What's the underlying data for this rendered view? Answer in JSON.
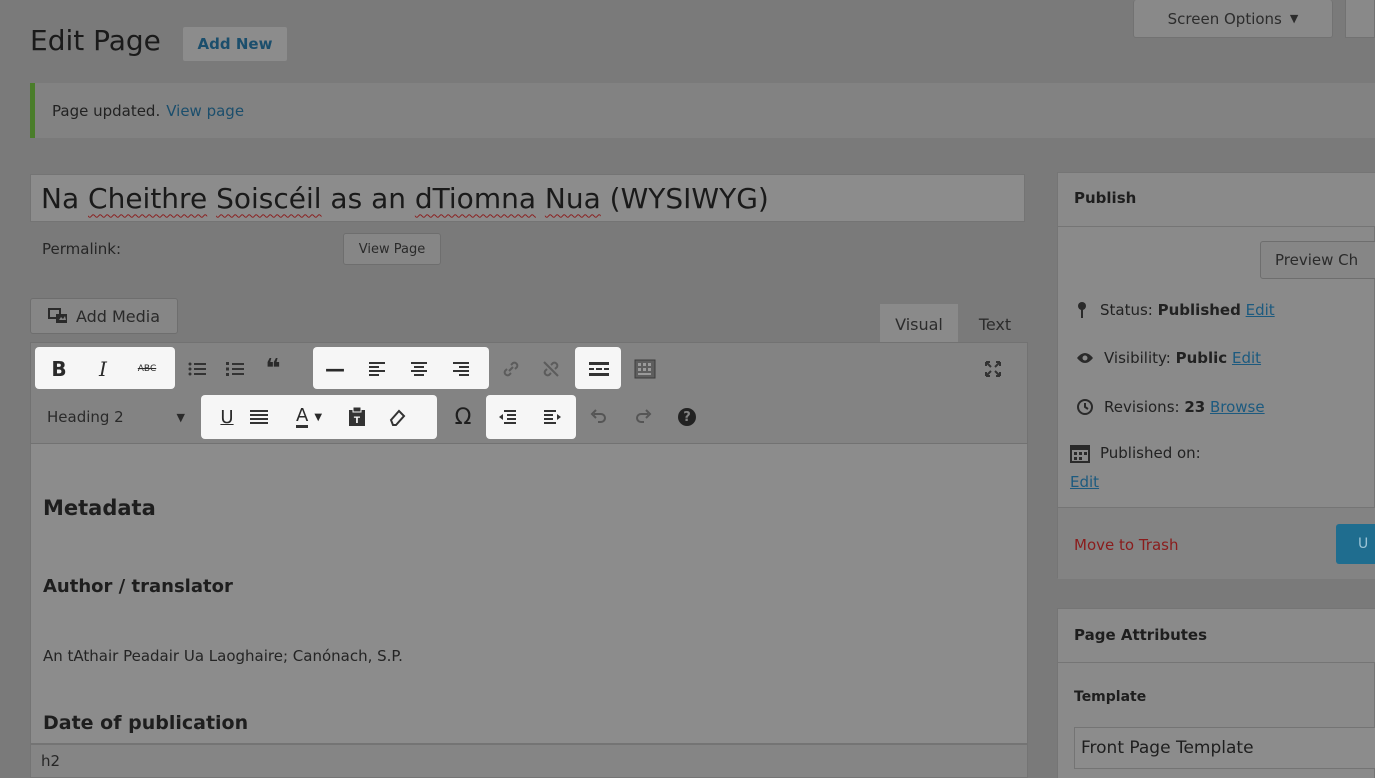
{
  "header": {
    "screen_options": "Screen Options",
    "page_title": "Edit Page",
    "add_new": "Add New"
  },
  "notice": {
    "text": "Page updated.",
    "link": "View page"
  },
  "editor": {
    "title_parts": [
      "Na ",
      "Cheithre",
      " ",
      "Soiscéil",
      " as an ",
      "dTiomna",
      " ",
      "Nua",
      " (WYSIWYG)"
    ],
    "permalink_label": "Permalink:",
    "view_page_button": "View Page",
    "add_media_button": "Add Media",
    "tab_visual": "Visual",
    "tab_text": "Text",
    "format_select": "Heading 2",
    "toolbar_text": {
      "bold": "B",
      "italic": "I",
      "strike": "ABC",
      "quote": "❝",
      "hr": "—",
      "underline": "U",
      "textcolor": "A",
      "omega": "Ω",
      "help": "?"
    },
    "content": {
      "h_metadata": "Metadata",
      "h_author": "Author / translator",
      "author_text": "An tAthair Peadair Ua Laoghaire; Canónach, S.P.",
      "h_date": "Date of publication"
    },
    "status_path": "h2"
  },
  "publish_box": {
    "title": "Publish",
    "preview_button": "Preview Ch",
    "status_label": "Status: ",
    "status_value": "Published",
    "status_edit": "Edit",
    "visibility_label": "Visibility: ",
    "visibility_value": "Public",
    "visibility_edit": "Edit",
    "revisions_label": "Revisions: ",
    "revisions_value": "23",
    "revisions_browse": "Browse",
    "published_on_label": "Published on:",
    "published_on_edit": "Edit",
    "move_to_trash": "Move to Trash",
    "update_button": "U"
  },
  "page_attributes": {
    "title": "Page Attributes",
    "template_label": "Template",
    "template_value": "Front Page Template"
  },
  "colors": {
    "overlay_bg": "#7a7a7a",
    "highlight": "#f6f6f6",
    "link": "#1c5a7f",
    "trash": "#8a1c1c",
    "notice_border": "#4a7d2a",
    "update_button": "#1f6d8f"
  }
}
